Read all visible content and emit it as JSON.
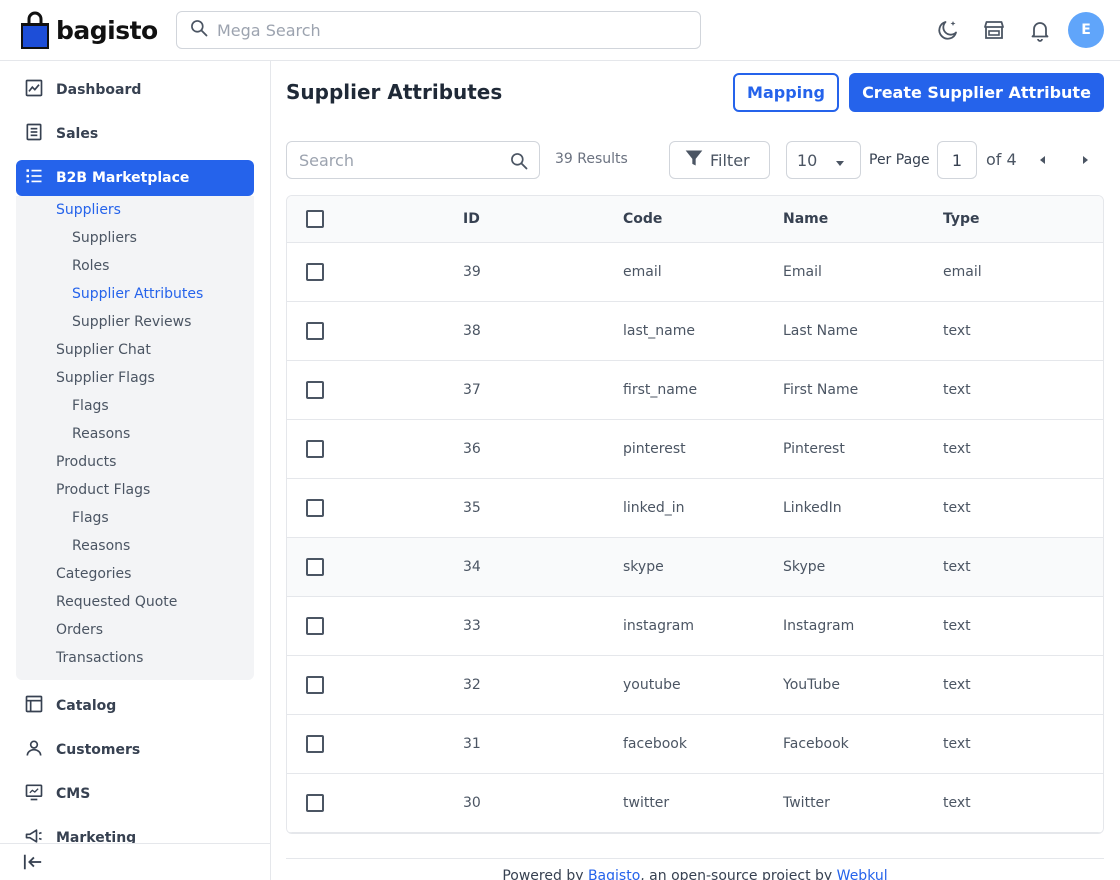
{
  "header": {
    "logo_text": "bagisto",
    "search_placeholder": "Mega Search",
    "avatar_initial": "E"
  },
  "sidebar": {
    "items": [
      {
        "label": "Dashboard"
      },
      {
        "label": "Sales"
      },
      {
        "label": "B2B Marketplace"
      },
      {
        "label": "Catalog"
      },
      {
        "label": "Customers"
      },
      {
        "label": "CMS"
      },
      {
        "label": "Marketing"
      }
    ],
    "sub_items": [
      {
        "label": "Suppliers"
      },
      {
        "label": "Suppliers"
      },
      {
        "label": "Roles"
      },
      {
        "label": "Supplier Attributes"
      },
      {
        "label": "Supplier Reviews"
      },
      {
        "label": "Supplier Chat"
      },
      {
        "label": "Supplier Flags"
      },
      {
        "label": "Flags"
      },
      {
        "label": "Reasons"
      },
      {
        "label": "Products"
      },
      {
        "label": "Product Flags"
      },
      {
        "label": "Flags"
      },
      {
        "label": "Reasons"
      },
      {
        "label": "Categories"
      },
      {
        "label": "Requested Quote"
      },
      {
        "label": "Orders"
      },
      {
        "label": "Transactions"
      }
    ]
  },
  "main": {
    "title": "Supplier Attributes",
    "mapping_label": "Mapping",
    "create_label": "Create Supplier Attribute"
  },
  "toolbar": {
    "search_placeholder": "Search",
    "results": "39 Results",
    "filter_label": "Filter",
    "per_page_value": "10",
    "per_page_label": "Per Page",
    "current_page": "1",
    "of_pages": "of 4"
  },
  "table": {
    "headers": {
      "id": "ID",
      "code": "Code",
      "name": "Name",
      "type": "Type"
    },
    "rows": [
      {
        "id": "39",
        "code": "email",
        "name": "Email",
        "type": "email"
      },
      {
        "id": "38",
        "code": "last_name",
        "name": "Last Name",
        "type": "text"
      },
      {
        "id": "37",
        "code": "first_name",
        "name": "First Name",
        "type": "text"
      },
      {
        "id": "36",
        "code": "pinterest",
        "name": "Pinterest",
        "type": "text"
      },
      {
        "id": "35",
        "code": "linked_in",
        "name": "LinkedIn",
        "type": "text"
      },
      {
        "id": "34",
        "code": "skype",
        "name": "Skype",
        "type": "text"
      },
      {
        "id": "33",
        "code": "instagram",
        "name": "Instagram",
        "type": "text"
      },
      {
        "id": "32",
        "code": "youtube",
        "name": "YouTube",
        "type": "text"
      },
      {
        "id": "31",
        "code": "facebook",
        "name": "Facebook",
        "type": "text"
      },
      {
        "id": "30",
        "code": "twitter",
        "name": "Twitter",
        "type": "text"
      }
    ]
  },
  "footer": {
    "prefix": "Powered by",
    "brand": "Bagisto",
    "middle": ", an open-source project by",
    "company": "Webkul"
  },
  "colors": {
    "accent": "#2563eb",
    "avatar": "#60a5fa"
  }
}
